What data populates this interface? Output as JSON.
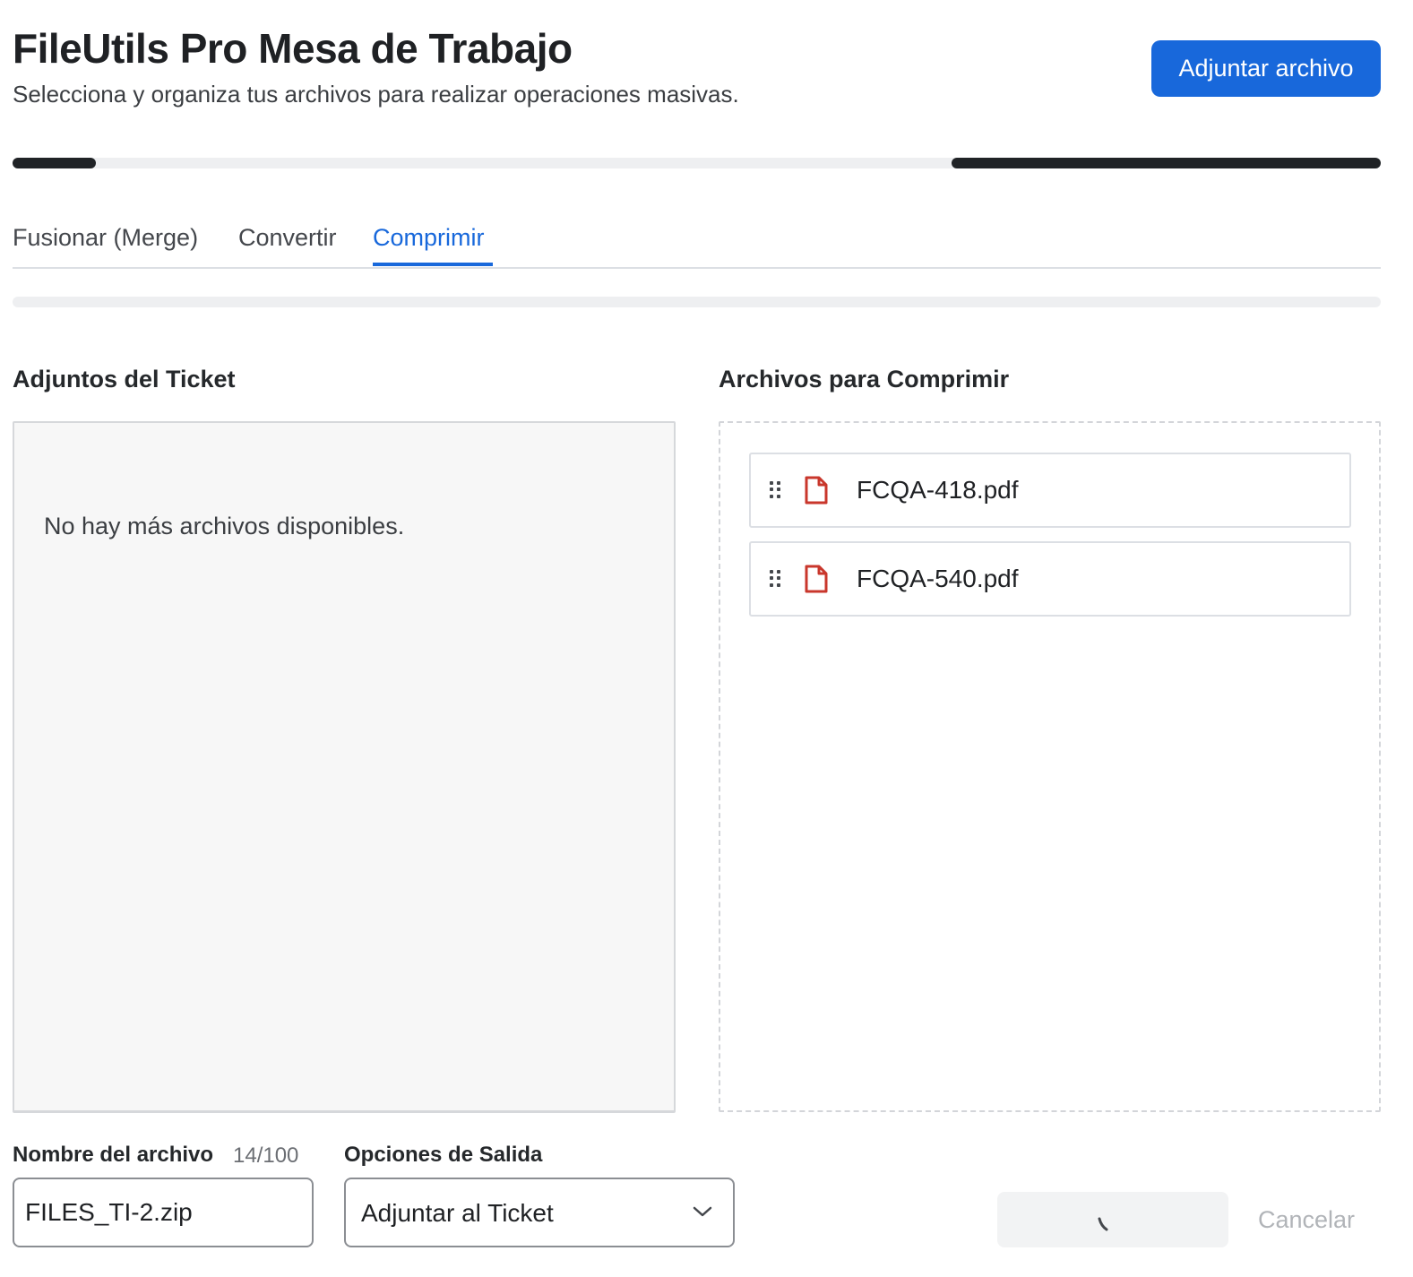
{
  "header": {
    "title": "FileUtils Pro Mesa de Trabajo",
    "subtitle": "Selecciona y organiza tus archivos para realizar operaciones masivas.",
    "attach_button": "Adjuntar archivo"
  },
  "tabs": [
    {
      "label": "Fusionar (Merge)",
      "active": false
    },
    {
      "label": "Convertir",
      "active": false
    },
    {
      "label": "Comprimir",
      "active": true
    }
  ],
  "left_panel": {
    "title": "Adjuntos del Ticket",
    "empty_message": "No hay más archivos disponibles."
  },
  "right_panel": {
    "title": "Archivos para Comprimir",
    "files": [
      {
        "name": "FCQA-418.pdf",
        "icon": "pdf-file-icon"
      },
      {
        "name": "FCQA-540.pdf",
        "icon": "pdf-file-icon"
      }
    ]
  },
  "footer": {
    "filename_label": "Nombre del archivo",
    "filename_counter": "14/100",
    "filename_value": "FILES_TI-2.zip",
    "output_label": "Opciones de Salida",
    "output_value": "Adjuntar al Ticket",
    "cancel_label": "Cancelar"
  },
  "colors": {
    "accent": "#1868db",
    "pdf_icon": "#c9372c"
  }
}
